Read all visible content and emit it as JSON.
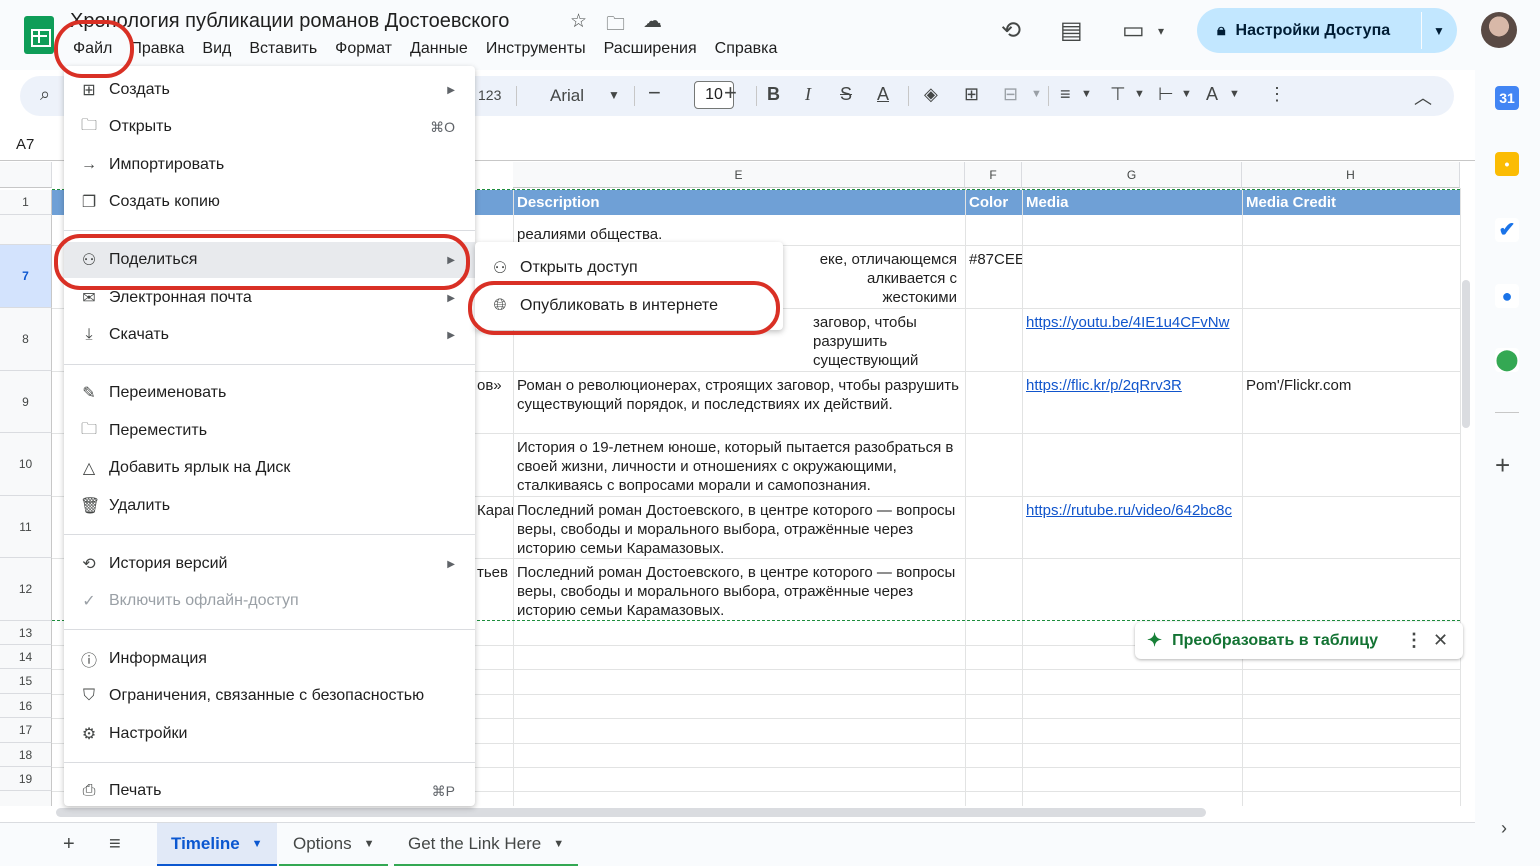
{
  "header": {
    "title": "Хронология публикации романов Достоевского",
    "menu": [
      "Файл",
      "Правка",
      "Вид",
      "Вставить",
      "Формат",
      "Данные",
      "Инструменты",
      "Расширения",
      "Справка"
    ],
    "share_button": "Настройки Доступа"
  },
  "toolbar": {
    "format_123": "123",
    "font": "Arial",
    "font_size": "10"
  },
  "name_box": "A7",
  "grid": {
    "columns": [
      "E",
      "F",
      "G",
      "H"
    ],
    "header_row": {
      "description": "Description",
      "color": "Color",
      "media": "Media",
      "media_credit": "Media Credit"
    },
    "rows": [
      "1",
      "7",
      "8",
      "9",
      "10",
      "11",
      "12",
      "13",
      "14",
      "15",
      "16",
      "17",
      "18",
      "19"
    ],
    "cells": {
      "r6_desc": "реалиями общества.",
      "r7_desc": "еке, отличающемся алкивается с жестокими",
      "r7_color": "#87CEE",
      "r8_desc": "заговор, чтобы разрушить существующий порядок, и последствиях их действий.",
      "r8_media": "https://youtu.be/4IE1u4CFvNw",
      "r9_left": "ов»",
      "r9_desc": "Роман о революционерах, строящих заговор, чтобы разрушить существующий порядок, и последствиях их действий.",
      "r9_media": "https://flic.kr/p/2qRrv3R",
      "r9_credit": "Pom'/Flickr.com",
      "r10_desc": "История о 19-летнем юноше, который пытается разобраться в своей жизни, личности и отношениях с окружающими, сталкиваясь с вопросами морали и самопознания.",
      "r11_left": "Карам",
      "r11_desc": "Последний роман Достоевского, в центре которого — вопросы веры, свободы и морального выбора, отражённые через историю семьи Карамазовых.",
      "r11_media": "https://rutube.ru/video/642bc8c",
      "r12_left": "тьев К",
      "r12_desc": "Последний роман Достоевского, в центре которого — вопросы веры, свободы и морального выбора, отражённые через историю семьи Карамазовых."
    }
  },
  "file_menu": {
    "items": [
      {
        "label": "Создать",
        "icon": "plus-box-icon",
        "submenu": true
      },
      {
        "label": "Открыть",
        "icon": "folder-icon",
        "shortcut": "⌘O"
      },
      {
        "label": "Импортировать",
        "icon": "import-icon"
      },
      {
        "label": "Создать копию",
        "icon": "copy-icon"
      },
      {
        "label": "Поделиться",
        "icon": "person-add-icon",
        "submenu": true,
        "highlighted": true
      },
      {
        "label": "Электронная почта",
        "icon": "mail-icon",
        "submenu": true
      },
      {
        "label": "Скачать",
        "icon": "download-icon",
        "submenu": true
      },
      {
        "label": "Переименовать",
        "icon": "pencil-icon"
      },
      {
        "label": "Переместить",
        "icon": "move-folder-icon"
      },
      {
        "label": "Добавить ярлык на Диск",
        "icon": "drive-shortcut-icon"
      },
      {
        "label": "Удалить",
        "icon": "trash-icon"
      },
      {
        "label": "История версий",
        "icon": "history-icon",
        "submenu": true
      },
      {
        "label": "Включить офлайн-доступ",
        "icon": "offline-icon",
        "disabled": true
      },
      {
        "label": "Информация",
        "icon": "info-icon"
      },
      {
        "label": "Ограничения, связанные с безопасностью",
        "icon": "shield-icon"
      },
      {
        "label": "Настройки",
        "icon": "gear-icon"
      },
      {
        "label": "Печать",
        "icon": "printer-icon",
        "shortcut": "⌘P"
      }
    ]
  },
  "share_submenu": {
    "items": [
      {
        "label": "Открыть доступ",
        "icon": "person-add-icon"
      },
      {
        "label": "Опубликовать в интернете",
        "icon": "globe-icon"
      }
    ]
  },
  "convert_chip": {
    "label": "Преобразовать в таблицу"
  },
  "sheet_tabs": [
    {
      "label": "Timeline",
      "active": true
    },
    {
      "label": "Options"
    },
    {
      "label": "Get the Link Here"
    }
  ],
  "colors": {
    "header_row": "#6fa0d6",
    "accent": "#0b57d0",
    "highlight_oval": "#d93025",
    "share_button_bg": "#c2e7ff",
    "sheets_green": "#0f9d58"
  }
}
